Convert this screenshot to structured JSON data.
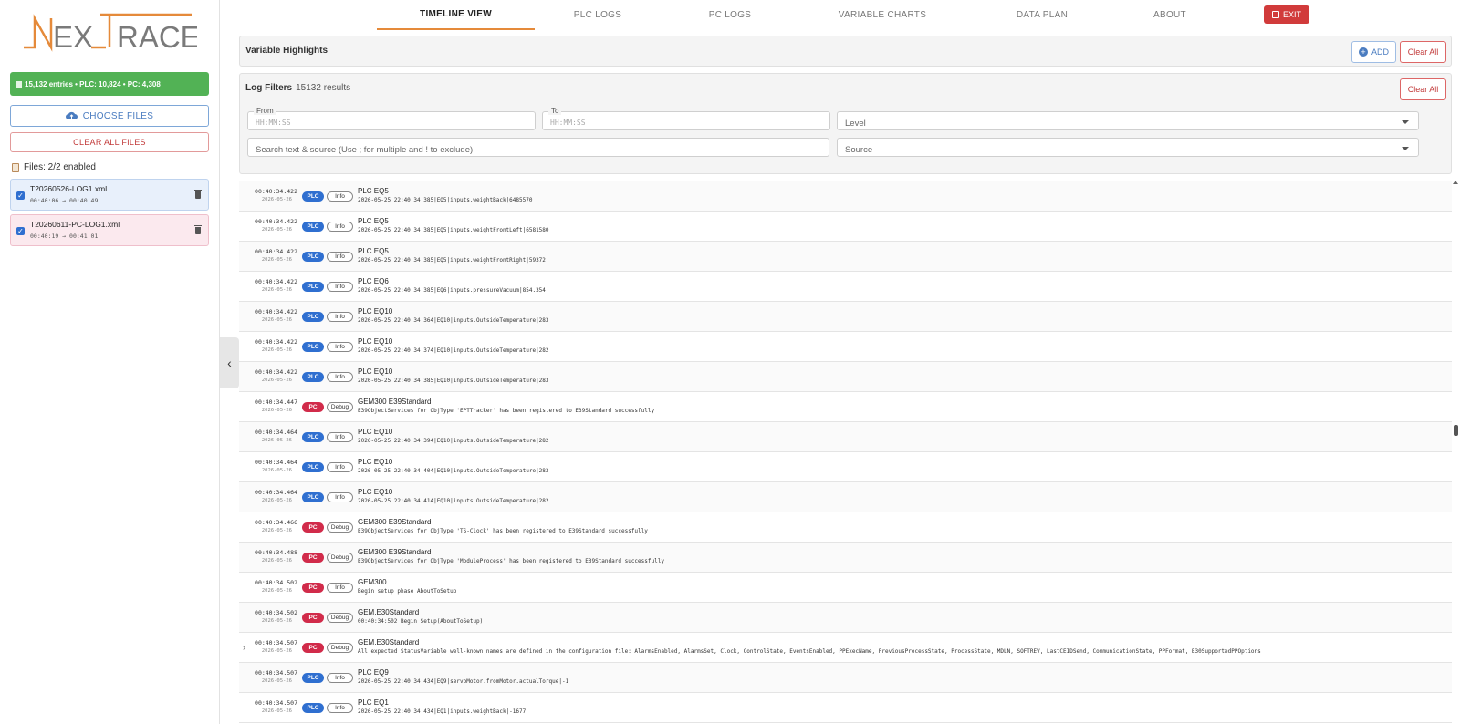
{
  "brand": {
    "logo_text": "NEXTRACE",
    "accent": "#e58a3a"
  },
  "sidebar": {
    "summary": "15,132 entries • PLC: 10,824 • PC: 4,308",
    "choose_files": "CHOOSE FILES",
    "clear_all_files": "CLEAR ALL FILES",
    "files_label": "Files: 2/2 enabled",
    "files": [
      {
        "name": "T20260526-LOG1.xml",
        "range": "00:40:06 → 00:40:49",
        "type": "plc",
        "enabled": true
      },
      {
        "name": "T20260611-PC-LOG1.xml",
        "range": "00:40:19 → 00:41:01",
        "type": "pc",
        "enabled": true
      }
    ],
    "collapse_icon": "chevron-left-icon"
  },
  "nav": {
    "tabs": [
      "TIMELINE VIEW",
      "PLC LOGS",
      "PC LOGS",
      "VARIABLE CHARTS",
      "DATA PLAN",
      "ABOUT"
    ],
    "active_tab": "TIMELINE VIEW",
    "exit_label": "EXIT"
  },
  "highlights": {
    "title": "Variable Highlights",
    "add_label": "ADD",
    "clear_label": "Clear All"
  },
  "filters": {
    "title": "Log Filters",
    "count": "15132 results",
    "clear_label": "Clear All",
    "from_label": "From",
    "from_placeholder": "HH:MM:SS",
    "to_label": "To",
    "to_placeholder": "HH:MM:SS",
    "level_placeholder": "Level",
    "search_placeholder": "Search text & source (Use ; for multiple and ! to exclude)",
    "source_placeholder": "Source"
  },
  "colors": {
    "plc": "#2f6fd0",
    "pc": "#d12b4a",
    "summary_green": "#52b255",
    "exit_red": "#d13b3b"
  },
  "logs": [
    {
      "time": "00:40:34.422",
      "date": "2026-05-26",
      "type": "PLC",
      "level": "Info",
      "source": "PLC EQ5",
      "message": "2026-05-25 22:40:34.385|EQ5|inputs.weightBack|6485570"
    },
    {
      "time": "00:40:34.422",
      "date": "2026-05-26",
      "type": "PLC",
      "level": "Info",
      "source": "PLC EQ5",
      "message": "2026-05-25 22:40:34.385|EQ5|inputs.weightFrontLeft|6581580"
    },
    {
      "time": "00:40:34.422",
      "date": "2026-05-26",
      "type": "PLC",
      "level": "Info",
      "source": "PLC EQ5",
      "message": "2026-05-25 22:40:34.385|EQ5|inputs.weightFrontRight|59372"
    },
    {
      "time": "00:40:34.422",
      "date": "2026-05-26",
      "type": "PLC",
      "level": "Info",
      "source": "PLC EQ6",
      "message": "2026-05-25 22:40:34.385|EQ6|inputs.pressureVacuum|854.354"
    },
    {
      "time": "00:40:34.422",
      "date": "2026-05-26",
      "type": "PLC",
      "level": "Info",
      "source": "PLC EQ10",
      "message": "2026-05-25 22:40:34.364|EQ10|inputs.OutsideTemperature|283"
    },
    {
      "time": "00:40:34.422",
      "date": "2026-05-26",
      "type": "PLC",
      "level": "Info",
      "source": "PLC EQ10",
      "message": "2026-05-25 22:40:34.374|EQ10|inputs.OutsideTemperature|282"
    },
    {
      "time": "00:40:34.422",
      "date": "2026-05-26",
      "type": "PLC",
      "level": "Info",
      "source": "PLC EQ10",
      "message": "2026-05-25 22:40:34.385|EQ10|inputs.OutsideTemperature|283"
    },
    {
      "time": "00:40:34.447",
      "date": "2026-05-26",
      "type": "PC",
      "level": "Debug",
      "source": "GEM300 E39Standard",
      "message": "E39ObjectServices for ObjType 'EPTTracker' has been registered to E39Standard successfully"
    },
    {
      "time": "00:40:34.464",
      "date": "2026-05-26",
      "type": "PLC",
      "level": "Info",
      "source": "PLC EQ10",
      "message": "2026-05-25 22:40:34.394|EQ10|inputs.OutsideTemperature|282"
    },
    {
      "time": "00:40:34.464",
      "date": "2026-05-26",
      "type": "PLC",
      "level": "Info",
      "source": "PLC EQ10",
      "message": "2026-05-25 22:40:34.404|EQ10|inputs.OutsideTemperature|283"
    },
    {
      "time": "00:40:34.464",
      "date": "2026-05-26",
      "type": "PLC",
      "level": "Info",
      "source": "PLC EQ10",
      "message": "2026-05-25 22:40:34.414|EQ10|inputs.OutsideTemperature|282"
    },
    {
      "time": "00:40:34.466",
      "date": "2026-05-26",
      "type": "PC",
      "level": "Debug",
      "source": "GEM300 E39Standard",
      "message": "E39ObjectServices for ObjType 'TS-Clock' has been registered to E39Standard successfully"
    },
    {
      "time": "00:40:34.488",
      "date": "2026-05-26",
      "type": "PC",
      "level": "Debug",
      "source": "GEM300 E39Standard",
      "message": "E39ObjectServices for ObjType 'ModuleProcess' has been registered to E39Standard successfully"
    },
    {
      "time": "00:40:34.502",
      "date": "2026-05-26",
      "type": "PC",
      "level": "Info",
      "source": "GEM300",
      "message": "Begin setup phase AboutToSetup"
    },
    {
      "time": "00:40:34.502",
      "date": "2026-05-26",
      "type": "PC",
      "level": "Debug",
      "source": "GEM.E30Standard",
      "message": "00:40:34:502 Begin Setup(AboutToSetup)"
    },
    {
      "time": "00:40:34.507",
      "date": "2026-05-26",
      "type": "PC",
      "level": "Debug",
      "source": "GEM.E30Standard",
      "message": "All expected StatusVariable well-known names are defined in the configuration file: AlarmsEnabled, AlarmsSet, Clock, ControlState, EventsEnabled, PPExecName, PreviousProcessState, ProcessState, MDLN, SOFTREV, LastCEIDSend, CommunicationState, PPFormat, E30SupportedPPOptions",
      "expandable": true
    },
    {
      "time": "00:40:34.507",
      "date": "2026-05-26",
      "type": "PLC",
      "level": "Info",
      "source": "PLC EQ9",
      "message": "2026-05-25 22:40:34.434|EQ9|servoMotor.fromMotor.actualTorque|-1"
    },
    {
      "time": "00:40:34.507",
      "date": "2026-05-26",
      "type": "PLC",
      "level": "Info",
      "source": "PLC EQ1",
      "message": "2026-05-25 22:40:34.434|EQ1|inputs.weightBack|-1677"
    }
  ]
}
